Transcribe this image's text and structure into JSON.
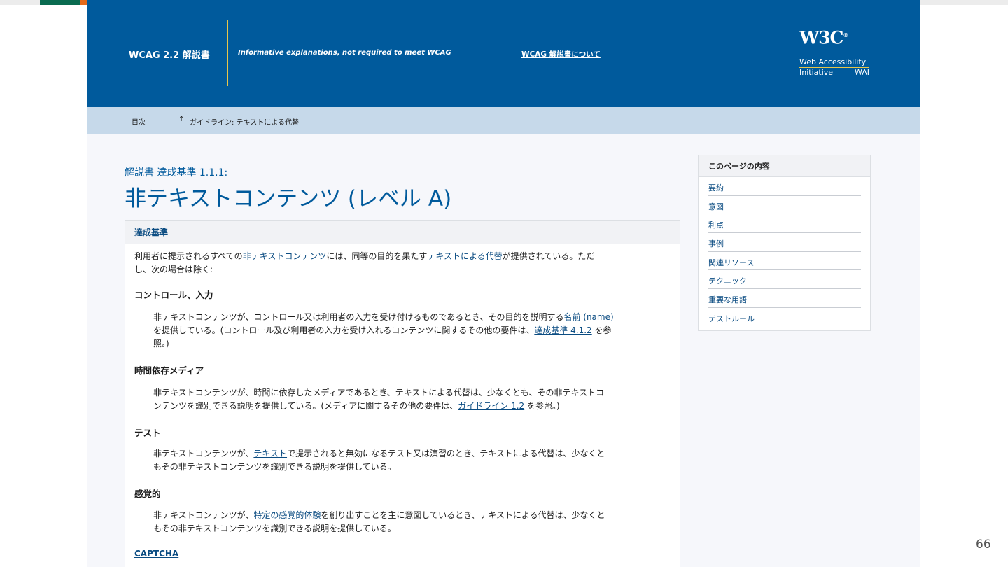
{
  "header": {
    "doc_title": "WCAG 2.2 解説書",
    "tagline": "Informative explanations, not required to meet WCAG",
    "about_link": "WCAG 解説書について",
    "logo_text": "W3C",
    "logo_sup": "®",
    "logo_line1": "Web Accessibility",
    "logo_line2a": "Initiative",
    "logo_line2b": "WAI"
  },
  "breadcrumb": {
    "toc": "目次",
    "arrow": "↑",
    "guideline": "ガイドライン: テキストによる代替"
  },
  "main": {
    "pretitle": "解説書 達成基準 1.1.1:",
    "title": "非テキストコンテンツ (レベル A)",
    "box_header": "達成基準",
    "intro_a": "利用者に提示されるすべての",
    "intro_link1": "非テキストコンテンツ",
    "intro_b": "には、同等の目的を果たす",
    "intro_link2": "テキストによる代替",
    "intro_c": "が提供されている。ただ",
    "intro_d": "し、次の場合は除く:",
    "s1_heading": "コントロール、入力",
    "s1_a": "非テキストコンテンツが、コントロール又は利用者の入力を受け付けるものであるとき、その目的を説明する",
    "s1_link1": "名前 (name)",
    "s1_b": "を提供している。(コントロール及び利用者の入力を受け入れるコンテンツに関するその他の要件は、",
    "s1_link2": "達成基準 4.1.2",
    "s1_c": " を参",
    "s1_d": "照。)",
    "s2_heading": "時間依存メディア",
    "s2_a": "非テキストコンテンツが、時間に依存したメディアであるとき、テキストによる代替は、少なくとも、その非テキストコ",
    "s2_b": "ンテンツを識別できる説明を提供している。(メディアに関するその他の要件は、",
    "s2_link": "ガイドライン 1.2",
    "s2_c": " を参照。)",
    "s3_heading": "テスト",
    "s3_a": "非テキストコンテンツが、",
    "s3_link": "テキスト",
    "s3_b": "で提示されると無効になるテスト又は演習のとき、テキストによる代替は、少なくと",
    "s3_c": "もその非テキストコンテンツを識別できる説明を提供している。",
    "s4_heading": "感覚的",
    "s4_a": "非テキストコンテンツが、",
    "s4_link": "特定の感覚的体験",
    "s4_b": "を創り出すことを主に意図しているとき、テキストによる代替は、少なくと",
    "s4_c": "もその非テキストコンテンツを識別できる説明を提供している。",
    "captcha": "CAPTCHA"
  },
  "sidebar": {
    "title": "このページの内容",
    "items": [
      "要約",
      "意図",
      "利点",
      "事例",
      "関連リソース",
      "テクニック",
      "重要な用語",
      "テストルール"
    ]
  },
  "page_number": "66"
}
